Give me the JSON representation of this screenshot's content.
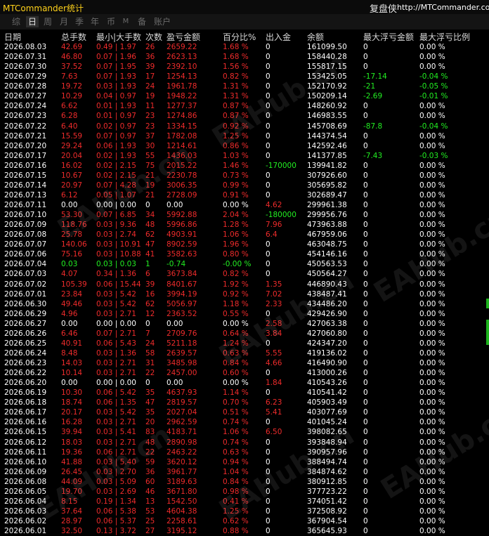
{
  "title": "MTCommander统计",
  "brand": {
    "name": "复盘侠",
    "url": "http://MTCommander.com"
  },
  "tabs": [
    {
      "label": "综",
      "active": false
    },
    {
      "label": "日",
      "active": true
    },
    {
      "label": "周",
      "active": false
    },
    {
      "label": "月",
      "active": false
    },
    {
      "label": "季",
      "active": false
    },
    {
      "label": "年",
      "active": false
    },
    {
      "label": "币",
      "active": false
    },
    {
      "label": "M",
      "active": false
    },
    {
      "label": "备",
      "active": false
    },
    {
      "label": "账户",
      "active": false
    }
  ],
  "columns": [
    "日期",
    "总手数",
    "最小|大手数",
    "次数",
    "盈亏金额",
    "百分比%",
    "出入金",
    "余额",
    "最大浮亏金额",
    "最大浮亏比例"
  ],
  "watermark": "EAHub.cn",
  "colors": {
    "loss": "#ee2b2b",
    "gain": "#22ee22",
    "accent": "#ffd21a"
  },
  "rows": [
    [
      "2026.08.03",
      "42.69",
      "0.49 | 1.97",
      "26",
      "2659.22",
      "1.68 %",
      "0",
      "161099.50",
      "0",
      "0.00 %"
    ],
    [
      "2026.07.31",
      "46.80",
      "0.07 | 1.96",
      "36",
      "2623.13",
      "1.68 %",
      "0",
      "158440.28",
      "0",
      "0.00 %"
    ],
    [
      "2026.07.30",
      "37.52",
      "0.07 | 1.95",
      "39",
      "2392.10",
      "1.56 %",
      "0",
      "155817.15",
      "0",
      "0.00 %"
    ],
    [
      "2026.07.29",
      "7.63",
      "0.07 | 1.93",
      "17",
      "1254.13",
      "0.82 %",
      "0",
      "153425.05",
      "-17.14",
      "-0.04 %"
    ],
    [
      "2026.07.28",
      "19.72",
      "0.03 | 1.93",
      "24",
      "1961.78",
      "1.31 %",
      "0",
      "152170.92",
      "-21",
      "-0.05 %"
    ],
    [
      "2026.07.27",
      "10.29",
      "0.04 | 0.97",
      "19",
      "1948.22",
      "1.31 %",
      "0",
      "150209.14",
      "-2.69",
      "-0.01 %"
    ],
    [
      "2026.07.24",
      "6.62",
      "0.01 | 1.93",
      "11",
      "1277.37",
      "0.87 %",
      "0",
      "148260.92",
      "0",
      "0.00 %"
    ],
    [
      "2026.07.23",
      "6.28",
      "0.01 | 0.97",
      "23",
      "1274.86",
      "0.87 %",
      "0",
      "146983.55",
      "0",
      "0.00 %"
    ],
    [
      "2026.07.22",
      "6.40",
      "0.02 | 0.97",
      "23",
      "1334.15",
      "0.92 %",
      "0",
      "145708.69",
      "-87.8",
      "-0.04 %"
    ],
    [
      "2026.07.21",
      "15.59",
      "0.07 | 0.97",
      "37",
      "1782.08",
      "1.25 %",
      "0",
      "144374.54",
      "0",
      "0.00 %"
    ],
    [
      "2026.07.20",
      "29.24",
      "0.06 | 1.93",
      "30",
      "1214.61",
      "0.86 %",
      "0",
      "142592.46",
      "0",
      "0.00 %"
    ],
    [
      "2026.07.17",
      "20.04",
      "0.02 | 1.93",
      "55",
      "1436.03",
      "1.03 %",
      "0",
      "141377.85",
      "-7.43",
      "-0.03 %"
    ],
    [
      "2026.07.16",
      "16.02",
      "0.02 | 2.15",
      "75",
      "2015.22",
      "1.46 %",
      "-170000",
      "139941.82",
      "0",
      "0.00 %"
    ],
    [
      "2026.07.15",
      "10.67",
      "0.02 | 2.15",
      "21",
      "2230.78",
      "0.73 %",
      "0",
      "307926.60",
      "0",
      "0.00 %"
    ],
    [
      "2026.07.14",
      "20.97",
      "0.07 | 4.28",
      "19",
      "3006.35",
      "0.99 %",
      "0",
      "305695.82",
      "0",
      "0.00 %"
    ],
    [
      "2026.07.13",
      "6.12",
      "0.05 | 1.07",
      "21",
      "2728.09",
      "0.91 %",
      "0",
      "302689.47",
      "0",
      "0.00 %"
    ],
    [
      "2026.07.11",
      "0.00",
      "0.00 | 0.00",
      "0",
      "0.00",
      "0.00 %",
      "4.62",
      "299961.38",
      "0",
      "0.00 %"
    ],
    [
      "2026.07.10",
      "53.30",
      "0.07 | 6.85",
      "34",
      "5992.88",
      "2.04 %",
      "-180000",
      "299956.76",
      "0",
      "0.00 %"
    ],
    [
      "2026.07.09",
      "118.76",
      "0.03 | 9.36",
      "48",
      "5996.86",
      "1.28 %",
      "7.96",
      "473963.88",
      "0",
      "0.00 %"
    ],
    [
      "2026.07.08",
      "25.78",
      "0.03 | 2.74",
      "62",
      "4903.91",
      "1.06 %",
      "6.4",
      "467959.06",
      "0",
      "0.00 %"
    ],
    [
      "2026.07.07",
      "140.06",
      "0.03 | 10.91",
      "47",
      "8902.59",
      "1.96 %",
      "0",
      "463048.75",
      "0",
      "0.00 %"
    ],
    [
      "2026.07.06",
      "75.16",
      "0.03 | 10.88",
      "41",
      "3582.63",
      "0.80 %",
      "0",
      "454146.16",
      "0",
      "0.00 %"
    ],
    [
      "2026.07.04",
      "0.03",
      "0.03 | 0.03",
      "1",
      "-0.74",
      "-0.00 %",
      "0",
      "450563.53",
      "0",
      "0.00 %"
    ],
    [
      "2026.07.03",
      "4.07",
      "0.34 | 1.36",
      "6",
      "3673.84",
      "0.82 %",
      "0",
      "450564.27",
      "0",
      "0.00 %"
    ],
    [
      "2026.07.02",
      "105.39",
      "0.06 | 15.44",
      "39",
      "8401.67",
      "1.92 %",
      "1.35",
      "446890.43",
      "0",
      "0.00 %"
    ],
    [
      "2026.07.01",
      "23.84",
      "0.03 | 5.42",
      "16",
      "3994.19",
      "0.92 %",
      "7.02",
      "438487.41",
      "0",
      "0.00 %"
    ],
    [
      "2026.06.30",
      "49.46",
      "0.03 | 5.42",
      "62",
      "5056.97",
      "1.18 %",
      "2.33",
      "434486.20",
      "0",
      "0.00 %"
    ],
    [
      "2026.06.29",
      "4.96",
      "0.03 | 2.71",
      "12",
      "2363.52",
      "0.55 %",
      "0",
      "429426.90",
      "0",
      "0.00 %"
    ],
    [
      "2026.06.27",
      "0.00",
      "0.00 | 0.00",
      "0",
      "0.00",
      "0.00 %",
      "2.58",
      "427063.38",
      "0",
      "0.00 %"
    ],
    [
      "2026.06.26",
      "6.46",
      "0.07 | 2.71",
      "7",
      "2709.76",
      "0.64 %",
      "3.84",
      "427060.80",
      "0",
      "0.00 %"
    ],
    [
      "2026.06.25",
      "40.91",
      "0.06 | 5.43",
      "24",
      "5211.18",
      "1.24 %",
      "0",
      "424347.20",
      "0",
      "0.00 %"
    ],
    [
      "2026.06.24",
      "8.48",
      "0.03 | 1.36",
      "58",
      "2639.57",
      "0.63 %",
      "5.55",
      "419136.02",
      "0",
      "0.00 %"
    ],
    [
      "2026.06.23",
      "14.03",
      "0.03 | 2.71",
      "31",
      "3485.98",
      "0.84 %",
      "4.66",
      "416490.90",
      "0",
      "0.00 %"
    ],
    [
      "2026.06.22",
      "10.14",
      "0.03 | 2.71",
      "22",
      "2457.00",
      "0.60 %",
      "0",
      "413000.26",
      "0",
      "0.00 %"
    ],
    [
      "2026.06.20",
      "0.00",
      "0.00 | 0.00",
      "0",
      "0.00",
      "0.00 %",
      "1.84",
      "410543.26",
      "0",
      "0.00 %"
    ],
    [
      "2026.06.19",
      "10.30",
      "0.06 | 5.42",
      "35",
      "4637.93",
      "1.14 %",
      "0",
      "410541.42",
      "0",
      "0.00 %"
    ],
    [
      "2026.06.18",
      "18.74",
      "0.06 | 1.35",
      "47",
      "2819.57",
      "0.70 %",
      "6.23",
      "405903.49",
      "0",
      "0.00 %"
    ],
    [
      "2026.06.17",
      "20.17",
      "0.03 | 5.42",
      "35",
      "2027.04",
      "0.51 %",
      "5.41",
      "403077.69",
      "0",
      "0.00 %"
    ],
    [
      "2026.06.16",
      "16.28",
      "0.03 | 2.71",
      "20",
      "2962.59",
      "0.74 %",
      "0",
      "401045.24",
      "0",
      "0.00 %"
    ],
    [
      "2026.06.15",
      "39.94",
      "0.03 | 5.41",
      "83",
      "4183.71",
      "1.06 %",
      "6.50",
      "398082.65",
      "0",
      "0.00 %"
    ],
    [
      "2026.06.12",
      "18.03",
      "0.03 | 2.71",
      "48",
      "2890.98",
      "0.74 %",
      "0",
      "393848.94",
      "0",
      "0.00 %"
    ],
    [
      "2026.06.11",
      "19.36",
      "0.06 | 2.71",
      "22",
      "2463.22",
      "0.63 %",
      "0",
      "390957.96",
      "0",
      "0.00 %"
    ],
    [
      "2026.06.10",
      "41.88",
      "0.03 | 5.40",
      "59",
      "3620.12",
      "0.94 %",
      "0",
      "388494.74",
      "0",
      "0.00 %"
    ],
    [
      "2026.06.09",
      "26.45",
      "0.03 | 2.70",
      "36",
      "3961.77",
      "1.04 %",
      "0",
      "384874.62",
      "0",
      "0.00 %"
    ],
    [
      "2026.06.08",
      "44.09",
      "0.03 | 5.09",
      "60",
      "3189.63",
      "0.84 %",
      "0",
      "380912.85",
      "0",
      "0.00 %"
    ],
    [
      "2026.06.05",
      "19.70",
      "0.03 | 2.69",
      "46",
      "3671.80",
      "0.98 %",
      "0",
      "377723.22",
      "0",
      "0.00 %"
    ],
    [
      "2026.06.04",
      "8.15",
      "0.19 | 1.34",
      "13",
      "1542.50",
      "0.41 %",
      "0",
      "374051.42",
      "0",
      "0.00 %"
    ],
    [
      "2026.06.03",
      "37.64",
      "0.06 | 5.38",
      "53",
      "4604.38",
      "1.25 %",
      "0",
      "372508.92",
      "0",
      "0.00 %"
    ],
    [
      "2026.06.02",
      "28.97",
      "0.06 | 5.37",
      "25",
      "2258.61",
      "0.62 %",
      "0",
      "367904.54",
      "0",
      "0.00 %"
    ],
    [
      "2026.06.01",
      "32.50",
      "0.13 | 3.72",
      "27",
      "3195.12",
      "0.88 %",
      "0",
      "365645.93",
      "0",
      "0.00 %"
    ]
  ]
}
